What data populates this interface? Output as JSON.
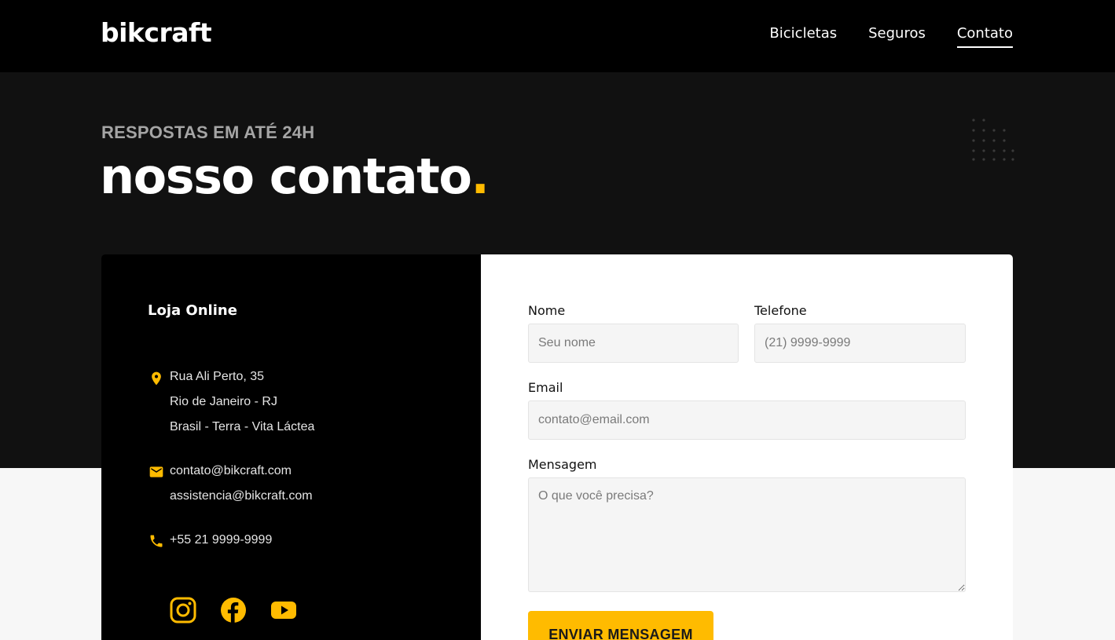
{
  "header": {
    "logo": "bikcraft",
    "nav": [
      {
        "label": "Bicicletas"
      },
      {
        "label": "Seguros"
      },
      {
        "label": "Contato"
      }
    ]
  },
  "hero": {
    "subtitle": "RESPOSTAS EM ATÉ 24H",
    "title": "nosso contato",
    "title_dot": "."
  },
  "contact_info": {
    "title": "Loja Online",
    "address": [
      "Rua Ali Perto, 35",
      "Rio de Janeiro - RJ",
      "Brasil - Terra - Vita Láctea"
    ],
    "emails": [
      "contato@bikcraft.com",
      "assistencia@bikcraft.com"
    ],
    "phone": "+55 21 9999-9999",
    "social": [
      "instagram-icon",
      "facebook-icon",
      "youtube-icon"
    ]
  },
  "form": {
    "name_label": "Nome",
    "name_placeholder": "Seu nome",
    "phone_label": "Telefone",
    "phone_placeholder": "(21) 9999-9999",
    "email_label": "Email",
    "email_placeholder": "contato@email.com",
    "message_label": "Mensagem",
    "message_placeholder": "O que você precisa?",
    "submit_label": "ENVIAR MENSAGEM"
  },
  "colors": {
    "accent": "#ffbb00",
    "header_bg": "#000000",
    "hero_bg": "#111111",
    "page_bg": "#f7f7f7"
  }
}
